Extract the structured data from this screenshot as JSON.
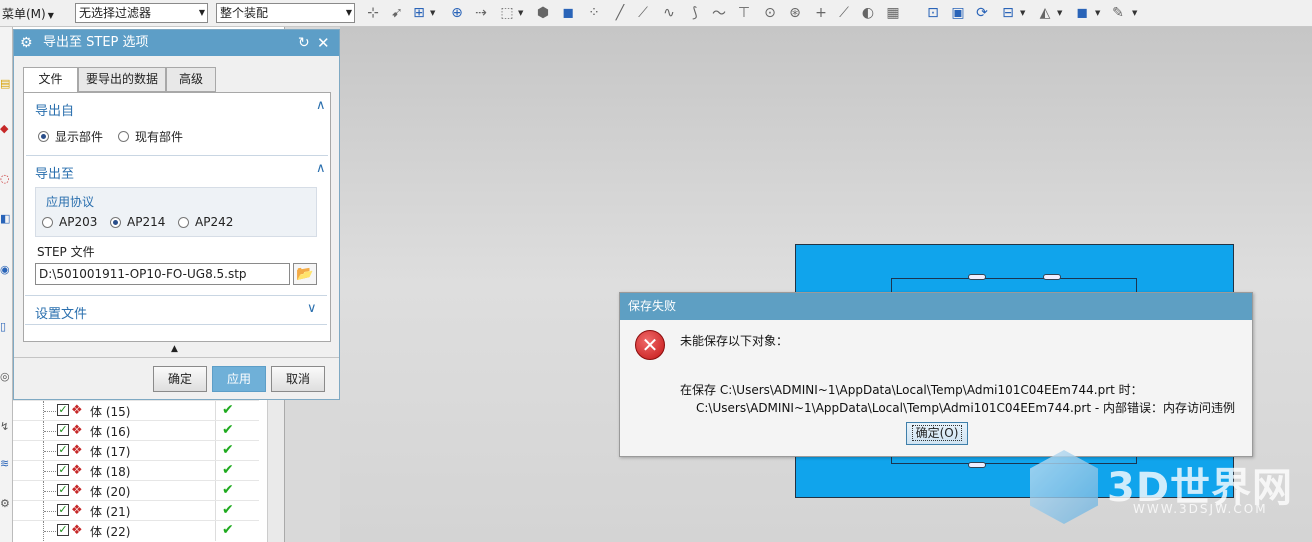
{
  "toolbar": {
    "menu_label": "菜单(M)",
    "filter_value": "无选择过滤器",
    "scope_value": "整个装配"
  },
  "export_dialog": {
    "title": "导出至 STEP 选项",
    "tabs": [
      "文件",
      "要导出的数据",
      "高级"
    ],
    "export_from": {
      "header": "导出自",
      "options": [
        "显示部件",
        "现有部件"
      ],
      "selected": "显示部件"
    },
    "export_to": {
      "header": "导出至",
      "protocol_label": "应用协议",
      "protocols": [
        "AP203",
        "AP214",
        "AP242"
      ],
      "selected_protocol": "AP214",
      "step_file_label": "STEP 文件",
      "step_file_value": "D:\\501001911-OP10-FO-UG8.5.stp"
    },
    "settings_file": {
      "header": "设置文件"
    },
    "buttons": {
      "ok": "确定",
      "apply": "应用",
      "cancel": "取消"
    }
  },
  "part_tree": {
    "rows": [
      {
        "label": "体 (15)"
      },
      {
        "label": "体 (16)"
      },
      {
        "label": "体 (17)"
      },
      {
        "label": "体 (18)"
      },
      {
        "label": "体 (20)"
      },
      {
        "label": "体 (21)"
      },
      {
        "label": "体 (22)"
      }
    ]
  },
  "error_dialog": {
    "title": "保存失败",
    "message": "未能保存以下对象：",
    "detail_line1": "在保存 C:\\Users\\ADMINI~1\\AppData\\Local\\Temp\\Admi101C04EEm744.prt 时：",
    "detail_line2": "C:\\Users\\ADMINI~1\\AppData\\Local\\Temp\\Admi101C04EEm744.prt -   内部错误：内存访问违例",
    "ok_label": "确定(O)"
  },
  "watermark": {
    "brand": "3D世界网",
    "url": "WWW.3DSJW.COM"
  },
  "colors": {
    "dialog_title": "#5d9ec7",
    "model_fill": "#10a4ec",
    "error_icon": "#c41616",
    "check_green": "#1faa1f"
  }
}
